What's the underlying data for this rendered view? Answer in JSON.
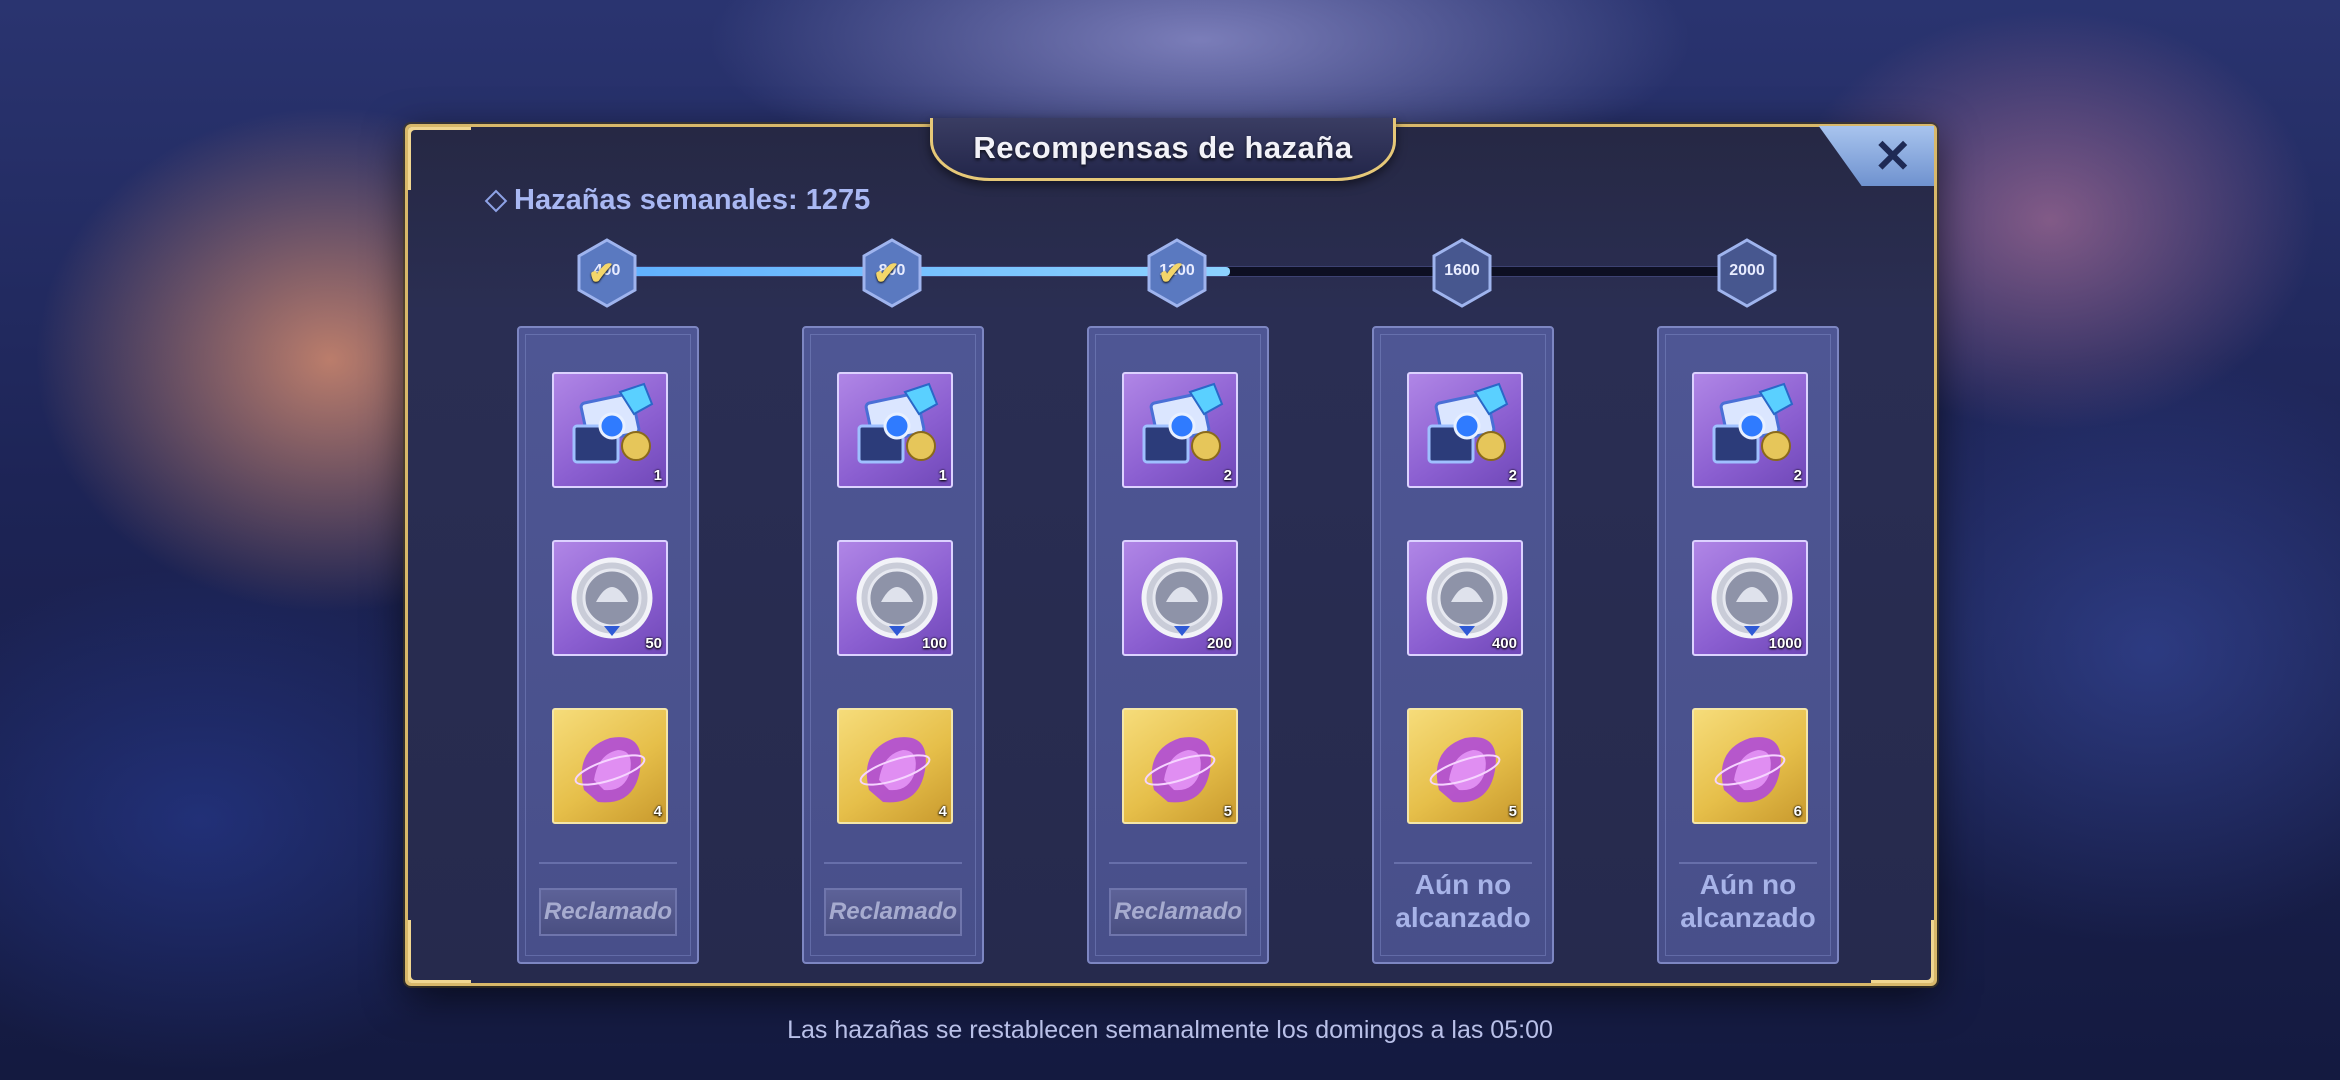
{
  "dialog": {
    "title": "Recompensas de hazaña",
    "weekly_label": "Hazañas semanales: 1275",
    "close_icon": "close-icon"
  },
  "progress": {
    "current": 1275,
    "milestones": [
      {
        "value": "400",
        "reached": true
      },
      {
        "value": "800",
        "reached": true
      },
      {
        "value": "1200",
        "reached": true
      },
      {
        "value": "1600",
        "reached": false
      },
      {
        "value": "2000",
        "reached": false
      }
    ]
  },
  "tiers": [
    {
      "items": [
        {
          "icon": "mystery-box-icon",
          "qty": "1"
        },
        {
          "icon": "silver-medal-icon",
          "qty": "50"
        },
        {
          "icon": "purple-essence-icon",
          "qty": "4"
        }
      ],
      "status": "Reclamado",
      "claimed": true
    },
    {
      "items": [
        {
          "icon": "mystery-box-icon",
          "qty": "1"
        },
        {
          "icon": "silver-medal-icon",
          "qty": "100"
        },
        {
          "icon": "purple-essence-icon",
          "qty": "4"
        }
      ],
      "status": "Reclamado",
      "claimed": true
    },
    {
      "items": [
        {
          "icon": "mystery-box-icon",
          "qty": "2"
        },
        {
          "icon": "silver-medal-icon",
          "qty": "200"
        },
        {
          "icon": "purple-essence-icon",
          "qty": "5"
        }
      ],
      "status": "Reclamado",
      "claimed": true
    },
    {
      "items": [
        {
          "icon": "mystery-box-icon",
          "qty": "2"
        },
        {
          "icon": "silver-medal-icon",
          "qty": "400"
        },
        {
          "icon": "purple-essence-icon",
          "qty": "5"
        }
      ],
      "status_line1": "Aún no",
      "status_line2": "alcanzado",
      "claimed": false
    },
    {
      "items": [
        {
          "icon": "mystery-box-icon",
          "qty": "2"
        },
        {
          "icon": "silver-medal-icon",
          "qty": "1000"
        },
        {
          "icon": "purple-essence-icon",
          "qty": "6"
        }
      ],
      "status_line1": "Aún no",
      "status_line2": "alcanzado",
      "claimed": false
    }
  ],
  "footer": "Las hazañas se restablecen semanalmente los domingos a las 05:00",
  "colors": {
    "gold_border": "#d8b86a",
    "progress_fill": "#5fb0ff",
    "panel": "#2b2f55"
  }
}
